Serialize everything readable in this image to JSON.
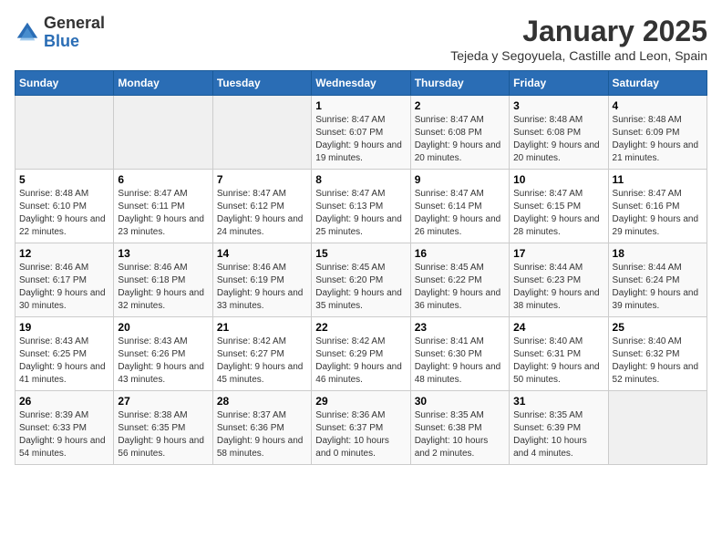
{
  "logo": {
    "general": "General",
    "blue": "Blue"
  },
  "title": "January 2025",
  "subtitle": "Tejeda y Segoyuela, Castille and Leon, Spain",
  "headers": [
    "Sunday",
    "Monday",
    "Tuesday",
    "Wednesday",
    "Thursday",
    "Friday",
    "Saturday"
  ],
  "weeks": [
    [
      {
        "day": "",
        "info": ""
      },
      {
        "day": "",
        "info": ""
      },
      {
        "day": "",
        "info": ""
      },
      {
        "day": "1",
        "info": "Sunrise: 8:47 AM\nSunset: 6:07 PM\nDaylight: 9 hours and 19 minutes."
      },
      {
        "day": "2",
        "info": "Sunrise: 8:47 AM\nSunset: 6:08 PM\nDaylight: 9 hours and 20 minutes."
      },
      {
        "day": "3",
        "info": "Sunrise: 8:48 AM\nSunset: 6:08 PM\nDaylight: 9 hours and 20 minutes."
      },
      {
        "day": "4",
        "info": "Sunrise: 8:48 AM\nSunset: 6:09 PM\nDaylight: 9 hours and 21 minutes."
      }
    ],
    [
      {
        "day": "5",
        "info": "Sunrise: 8:48 AM\nSunset: 6:10 PM\nDaylight: 9 hours and 22 minutes."
      },
      {
        "day": "6",
        "info": "Sunrise: 8:47 AM\nSunset: 6:11 PM\nDaylight: 9 hours and 23 minutes."
      },
      {
        "day": "7",
        "info": "Sunrise: 8:47 AM\nSunset: 6:12 PM\nDaylight: 9 hours and 24 minutes."
      },
      {
        "day": "8",
        "info": "Sunrise: 8:47 AM\nSunset: 6:13 PM\nDaylight: 9 hours and 25 minutes."
      },
      {
        "day": "9",
        "info": "Sunrise: 8:47 AM\nSunset: 6:14 PM\nDaylight: 9 hours and 26 minutes."
      },
      {
        "day": "10",
        "info": "Sunrise: 8:47 AM\nSunset: 6:15 PM\nDaylight: 9 hours and 28 minutes."
      },
      {
        "day": "11",
        "info": "Sunrise: 8:47 AM\nSunset: 6:16 PM\nDaylight: 9 hours and 29 minutes."
      }
    ],
    [
      {
        "day": "12",
        "info": "Sunrise: 8:46 AM\nSunset: 6:17 PM\nDaylight: 9 hours and 30 minutes."
      },
      {
        "day": "13",
        "info": "Sunrise: 8:46 AM\nSunset: 6:18 PM\nDaylight: 9 hours and 32 minutes."
      },
      {
        "day": "14",
        "info": "Sunrise: 8:46 AM\nSunset: 6:19 PM\nDaylight: 9 hours and 33 minutes."
      },
      {
        "day": "15",
        "info": "Sunrise: 8:45 AM\nSunset: 6:20 PM\nDaylight: 9 hours and 35 minutes."
      },
      {
        "day": "16",
        "info": "Sunrise: 8:45 AM\nSunset: 6:22 PM\nDaylight: 9 hours and 36 minutes."
      },
      {
        "day": "17",
        "info": "Sunrise: 8:44 AM\nSunset: 6:23 PM\nDaylight: 9 hours and 38 minutes."
      },
      {
        "day": "18",
        "info": "Sunrise: 8:44 AM\nSunset: 6:24 PM\nDaylight: 9 hours and 39 minutes."
      }
    ],
    [
      {
        "day": "19",
        "info": "Sunrise: 8:43 AM\nSunset: 6:25 PM\nDaylight: 9 hours and 41 minutes."
      },
      {
        "day": "20",
        "info": "Sunrise: 8:43 AM\nSunset: 6:26 PM\nDaylight: 9 hours and 43 minutes."
      },
      {
        "day": "21",
        "info": "Sunrise: 8:42 AM\nSunset: 6:27 PM\nDaylight: 9 hours and 45 minutes."
      },
      {
        "day": "22",
        "info": "Sunrise: 8:42 AM\nSunset: 6:29 PM\nDaylight: 9 hours and 46 minutes."
      },
      {
        "day": "23",
        "info": "Sunrise: 8:41 AM\nSunset: 6:30 PM\nDaylight: 9 hours and 48 minutes."
      },
      {
        "day": "24",
        "info": "Sunrise: 8:40 AM\nSunset: 6:31 PM\nDaylight: 9 hours and 50 minutes."
      },
      {
        "day": "25",
        "info": "Sunrise: 8:40 AM\nSunset: 6:32 PM\nDaylight: 9 hours and 52 minutes."
      }
    ],
    [
      {
        "day": "26",
        "info": "Sunrise: 8:39 AM\nSunset: 6:33 PM\nDaylight: 9 hours and 54 minutes."
      },
      {
        "day": "27",
        "info": "Sunrise: 8:38 AM\nSunset: 6:35 PM\nDaylight: 9 hours and 56 minutes."
      },
      {
        "day": "28",
        "info": "Sunrise: 8:37 AM\nSunset: 6:36 PM\nDaylight: 9 hours and 58 minutes."
      },
      {
        "day": "29",
        "info": "Sunrise: 8:36 AM\nSunset: 6:37 PM\nDaylight: 10 hours and 0 minutes."
      },
      {
        "day": "30",
        "info": "Sunrise: 8:35 AM\nSunset: 6:38 PM\nDaylight: 10 hours and 2 minutes."
      },
      {
        "day": "31",
        "info": "Sunrise: 8:35 AM\nSunset: 6:39 PM\nDaylight: 10 hours and 4 minutes."
      },
      {
        "day": "",
        "info": ""
      }
    ]
  ]
}
